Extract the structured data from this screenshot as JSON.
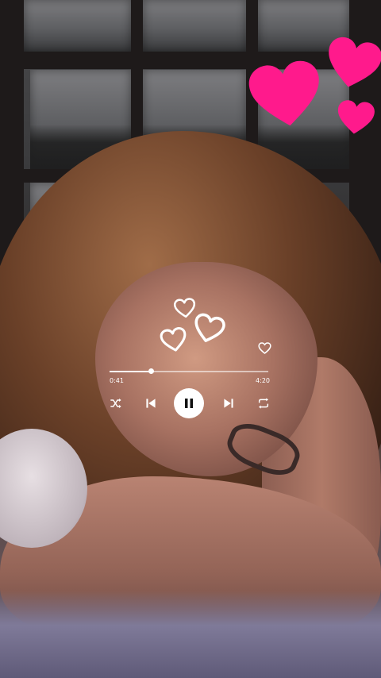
{
  "colors": {
    "heart_pink": "#ff1a8c",
    "player_white": "#ffffff"
  },
  "decorations": {
    "pink_hearts": [
      "heart-icon",
      "heart-icon",
      "heart-icon"
    ],
    "outline_hearts": [
      "heart-outline-icon",
      "heart-outline-icon",
      "heart-outline-icon"
    ]
  },
  "player": {
    "elapsed": "0:41",
    "total": "4:20",
    "progress": 0.26,
    "like_icon": "heart-outline-icon",
    "controls": {
      "shuffle_icon": "shuffle-icon",
      "previous_icon": "skip-previous-icon",
      "pause_icon": "pause-icon",
      "next_icon": "skip-next-icon",
      "repeat_icon": "repeat-icon"
    }
  }
}
